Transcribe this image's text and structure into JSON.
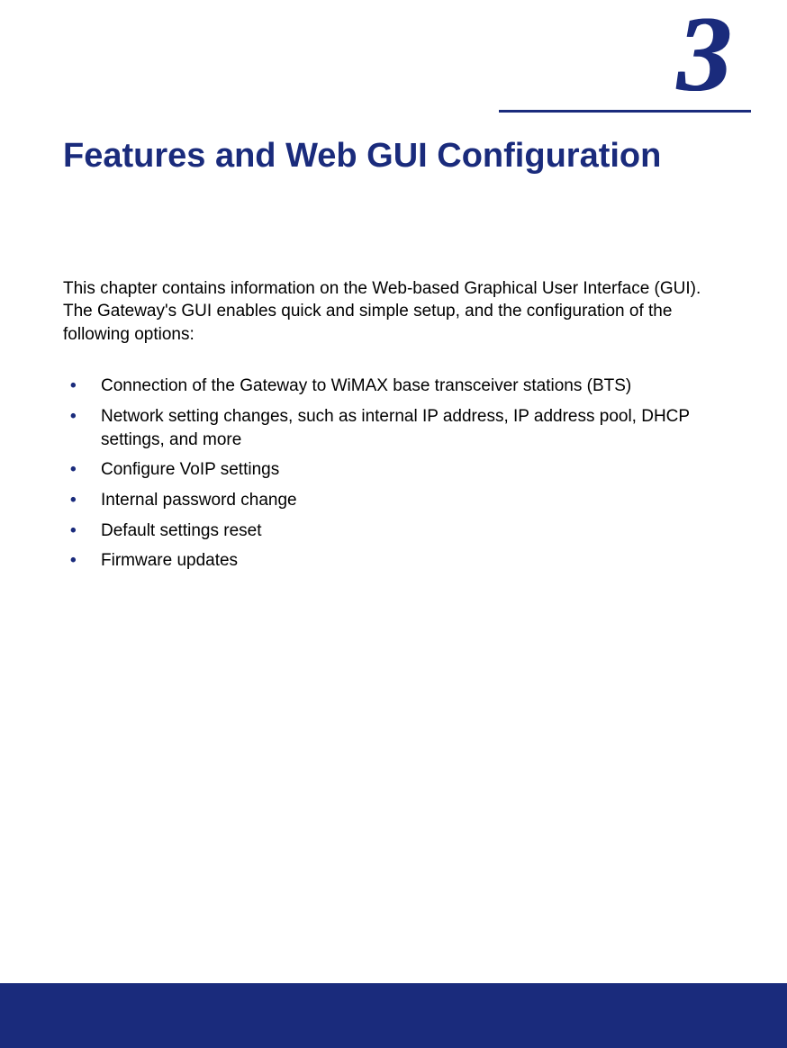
{
  "chapter": {
    "number": "3",
    "title": "Features and Web GUI Configuration"
  },
  "intro": "This chapter contains information on the Web-based Graphical User Interface (GUI). The Gateway's GUI enables quick and simple setup, and the configuration of the following options:",
  "bullets": [
    "Connection of the Gateway to WiMAX base transceiver stations (BTS)",
    "Network setting changes, such as internal IP address, IP address pool, DHCP settings, and more",
    "Configure VoIP settings",
    "Internal password change",
    "Default settings reset",
    "Firmware updates"
  ],
  "colors": {
    "brand": "#1a2b7c"
  }
}
